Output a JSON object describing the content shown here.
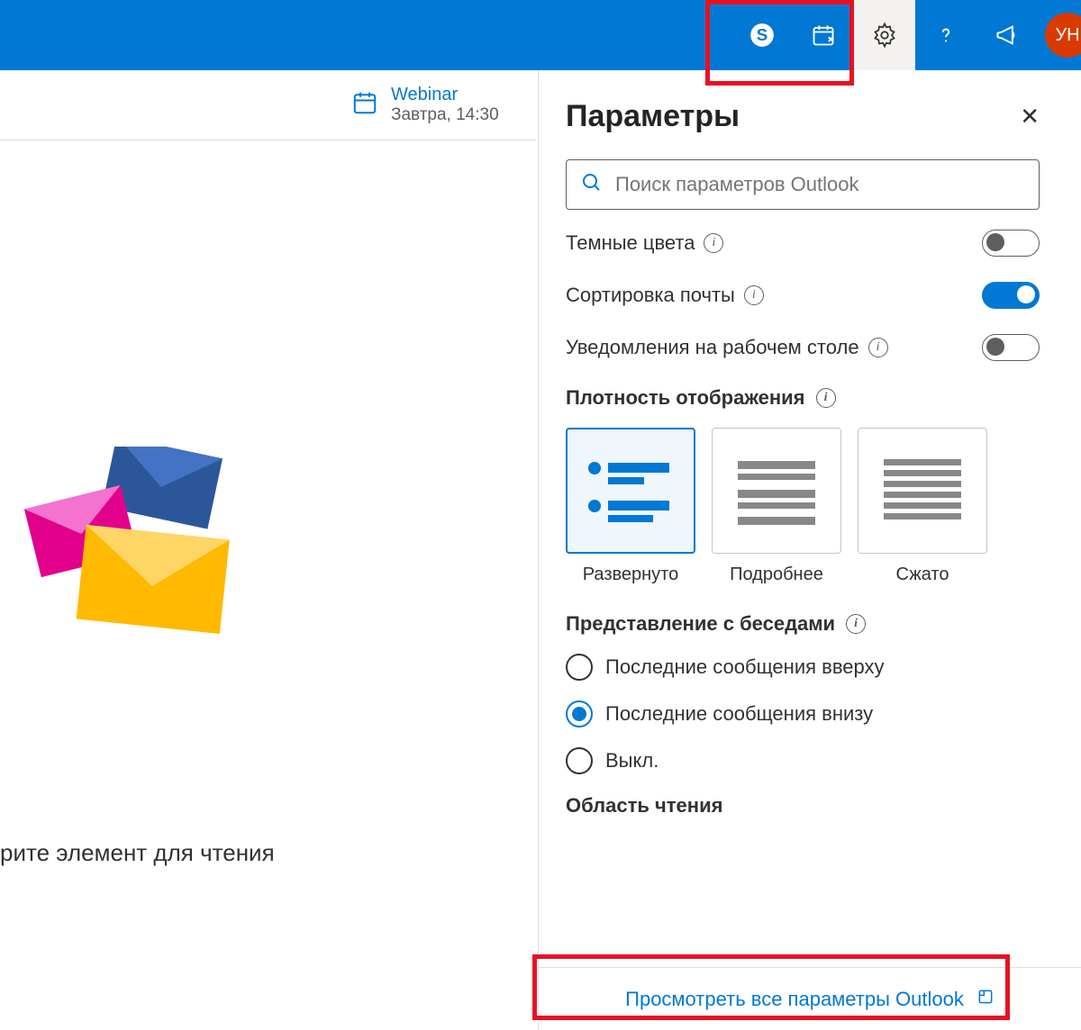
{
  "header": {
    "avatar_initials": "УН"
  },
  "infobar": {
    "title": "Webinar",
    "subtitle": "Завтра, 14:30"
  },
  "main": {
    "reading_prompt": "рите элемент для чтения"
  },
  "panel": {
    "title": "Параметры",
    "search_placeholder": "Поиск параметров Outlook",
    "dark_label": "Темные цвета",
    "sort_label": "Сортировка почты",
    "notif_label": "Уведомления на рабочем столе",
    "density_label": "Плотность отображения",
    "density_options": {
      "0": "Развернуто",
      "1": "Подробнее",
      "2": "Сжато"
    },
    "conversation_label": "Представление с беседами",
    "conversation_options": {
      "0": "Последние сообщения вверху",
      "1": "Последние сообщения внизу",
      "2": "Выкл."
    },
    "cutoff_section": "Область чтения",
    "view_all": "Просмотреть все параметры Outlook"
  }
}
